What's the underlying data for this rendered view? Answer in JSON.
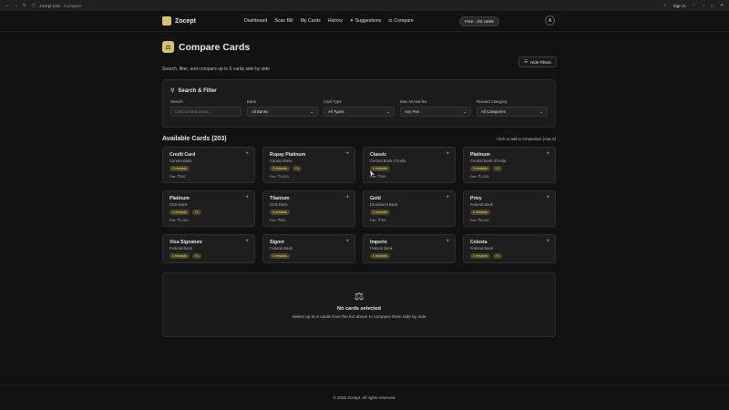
{
  "browser": {
    "url_prefix": "zocept.com",
    "url_path": "/compare",
    "signin": "Sign in"
  },
  "header": {
    "brand": "Zocept",
    "nav": [
      "Dashboard",
      "Scan Bill",
      "My Cards",
      "History",
      "Suggestions",
      "Compare"
    ],
    "plan_badge": "Free · 2/2 cards",
    "avatar_initial": "A"
  },
  "page": {
    "title": "Compare Cards",
    "subtitle": "Search, filter, and compare up to 6 cards side by side",
    "hide_filters": "Hide Filters"
  },
  "filters": {
    "heading": "Search & Filter",
    "search": {
      "label": "Search",
      "placeholder": "Card or bank name..."
    },
    "bank": {
      "label": "Bank",
      "value": "All Banks"
    },
    "card_type": {
      "label": "Card Type",
      "value": "All Types"
    },
    "max_fee": {
      "label": "Max Annual fee",
      "value": "Any Fee"
    },
    "reward_category": {
      "label": "Reward Category",
      "value": "All Categories"
    }
  },
  "available": {
    "heading": "Available Cards (203)",
    "hint": "Click to add to comparison (max 6)"
  },
  "cards": [
    {
      "name": "Credit Card",
      "bank": "Canara Bank",
      "badges": [
        "2 rewards"
      ],
      "fee": "Fee: ₹250"
    },
    {
      "name": "Rupay Platinum",
      "bank": "Canara Bank",
      "badges": [
        "2 rewards",
        "+1"
      ],
      "fee": "Fee: ₹1,000"
    },
    {
      "name": "Classic",
      "bank": "Central Bank of India",
      "badges": [
        "1 rewards"
      ],
      "fee": "Fee: ₹250"
    },
    {
      "name": "Platinum",
      "bank": "Central Bank of India",
      "badges": [
        "1 rewards",
        "+1"
      ],
      "fee": "Fee: ₹1,000"
    },
    {
      "name": "Platinum",
      "bank": "DCB Bank",
      "badges": [
        "1 rewards",
        "+1"
      ],
      "fee": "Fee: ₹1,000"
    },
    {
      "name": "Titanium",
      "bank": "DCB Bank",
      "badges": [
        "3 rewards"
      ],
      "fee": "Fee: ₹500"
    },
    {
      "name": "Gold",
      "bank": "Dhanlaxmi Bank",
      "badges": [
        "3 rewards"
      ],
      "fee": "Fee: ₹750"
    },
    {
      "name": "Privy",
      "bank": "Federal Bank",
      "badges": [
        "2 rewards"
      ],
      "fee": "Fee: ₹5,000"
    },
    {
      "name": "Visa Signature",
      "bank": "Federal Bank",
      "badges": [
        "1 rewards",
        "+1"
      ],
      "fee": "Fee: ₹2,999"
    },
    {
      "name": "Signet",
      "bank": "Federal Bank",
      "badges": [
        "1 rewards"
      ],
      "fee": "Fee: ₹500"
    },
    {
      "name": "Imperio",
      "bank": "Federal Bank",
      "badges": [
        "1 rewards"
      ],
      "fee": "Fee: ₹1,000"
    },
    {
      "name": "Celesta",
      "bank": "Federal Bank",
      "badges": [
        "1 rewards",
        "+1"
      ],
      "fee": "Fee: ₹2,999"
    }
  ],
  "empty_state": {
    "title": "No cards selected",
    "subtitle": "Select up to 6 cards from the list above to compare them side by side"
  },
  "footer": "© 2026 Zocept. All rights reserved."
}
